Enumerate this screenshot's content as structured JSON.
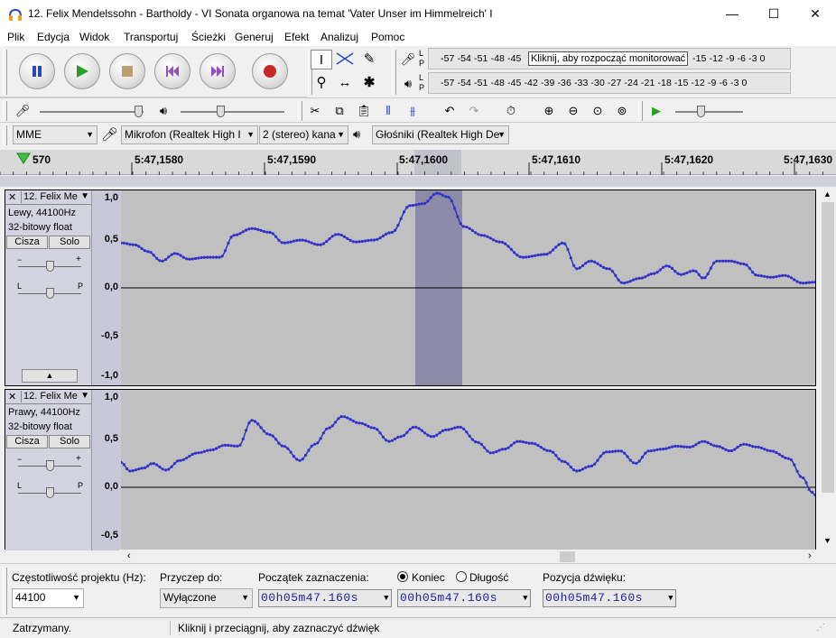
{
  "window": {
    "title": "12. Felix Mendelssohn - Bartholdy - VI Sonata organowa na temat 'Vater Unser im Himmelreich' I",
    "minimize": "—",
    "maximize": "☐",
    "close": "✕"
  },
  "menu": [
    "Plik",
    "Edycja",
    "Widok",
    "Transportuj",
    "Ścieżki",
    "Generuj",
    "Efekt",
    "Analizuj",
    "Pomoc"
  ],
  "meters": {
    "record_scale": "-57 -54 -51 -48 -45",
    "record_tooltip": "Kliknij, aby rozpocząć monitorować",
    "record_scale_right": "-15 -12  -9  -6  -3  0",
    "play_scale": "-57 -54 -51 -48 -45 -42 -39 -36 -33 -30 -27 -24 -21 -18 -15 -12  -9  -6  -3  0",
    "lr_top": "L",
    "lr_bottom": "P"
  },
  "device": {
    "host": "MME",
    "mic": "Mikrofon (Realtek High I",
    "channels": "2 (stereo) kana",
    "speakers": "Głośniki (Realtek High De"
  },
  "ruler": {
    "labels": [
      "570",
      "5:47,1580",
      "5:47,1590",
      "5:47,1600",
      "5:47,1610",
      "5:47,1620",
      "5:47,1630"
    ]
  },
  "tracks": [
    {
      "name": "12. Felix Me",
      "info1": "Lewy, 44100Hz",
      "info2": "32-bitowy float",
      "mute": "Cisza",
      "solo": "Solo",
      "gain_minus": "−",
      "gain_plus": "+",
      "pan_l": "L",
      "pan_p": "P",
      "scale": [
        "1,0",
        "0,5",
        "0,0",
        "-0,5",
        "-1,0"
      ]
    },
    {
      "name": "12. Felix Me",
      "info1": "Prawy, 44100Hz",
      "info2": "32-bitowy float",
      "mute": "Cisza",
      "solo": "Solo",
      "gain_minus": "−",
      "gain_plus": "+",
      "pan_l": "L",
      "pan_p": "P",
      "scale": [
        "1,0",
        "0,5",
        "0,0",
        "-0,5"
      ]
    }
  ],
  "bottom": {
    "rate_label": "Częstotliwość projektu (Hz):",
    "rate_value": "44100",
    "snap_label": "Przyczep do:",
    "snap_value": "Wyłączone",
    "sel_start_label": "Początek zaznaczenia:",
    "end_label": "Koniec",
    "length_label": "Długość",
    "audio_pos_label": "Pozycja dźwięku:",
    "time_value": "00h05m47.160s"
  },
  "status": {
    "state": "Zatrzymany.",
    "hint": "Kliknij i przeciągnij, aby zaznaczyć dźwięk"
  },
  "colors": {
    "waveform": "#3232c8",
    "selection": "#8c8ca8",
    "record_red": "#c82828",
    "play_green": "#28a028"
  }
}
